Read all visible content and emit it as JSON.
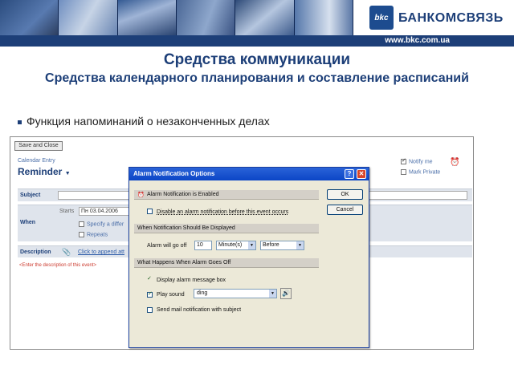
{
  "header": {
    "brand": "БАНКОМСВЯЗЬ",
    "logo_mark": "bkc",
    "url": "www.bkc.com.ua",
    "accent_color": "#1d3f78"
  },
  "slide": {
    "title": "Средства коммуникации",
    "subtitle": "Средства календарного планирования и составление расписаний",
    "bullet": "Функция напоминаний о незаконченных делах"
  },
  "calendar": {
    "save_close": "Save and Close",
    "entry_label": "Calendar Entry",
    "entry_type": "Reminder",
    "notify_me": "Notify me",
    "notify_me_checked": true,
    "mark_private": "Mark Private",
    "mark_private_checked": false,
    "subject_label": "Subject",
    "when_label": "When",
    "starts_label": "Starts",
    "start_date": "Пн 03.04.2006",
    "specify_label": "Specify a differ",
    "repeats_label": "Repeats",
    "description_label": "Description",
    "append_link": "Click to append att",
    "description_hint": "<Enter the description of this event>"
  },
  "dialog": {
    "title": "Alarm Notification Options",
    "help_button": "?",
    "close_button": "✕",
    "enabled_header": "Alarm Notification is Enabled",
    "disable_option": "Disable an alarm notification before this event occurs",
    "disable_checked": false,
    "when_header": "When Notification Should Be Displayed",
    "go_off_label": "Alarm will go off",
    "go_off_value": "10",
    "unit_value": "Minute(s)",
    "relation_value": "Before",
    "happens_header": "What Happens When Alarm Goes Off",
    "display_message": "Display alarm message box",
    "display_checked": true,
    "play_sound": "Play sound",
    "play_checked": true,
    "sound_value": "ding",
    "mail_notification": "Send mail notification with subject",
    "mail_checked": false,
    "ok_label": "OK",
    "cancel_label": "Cancel"
  }
}
